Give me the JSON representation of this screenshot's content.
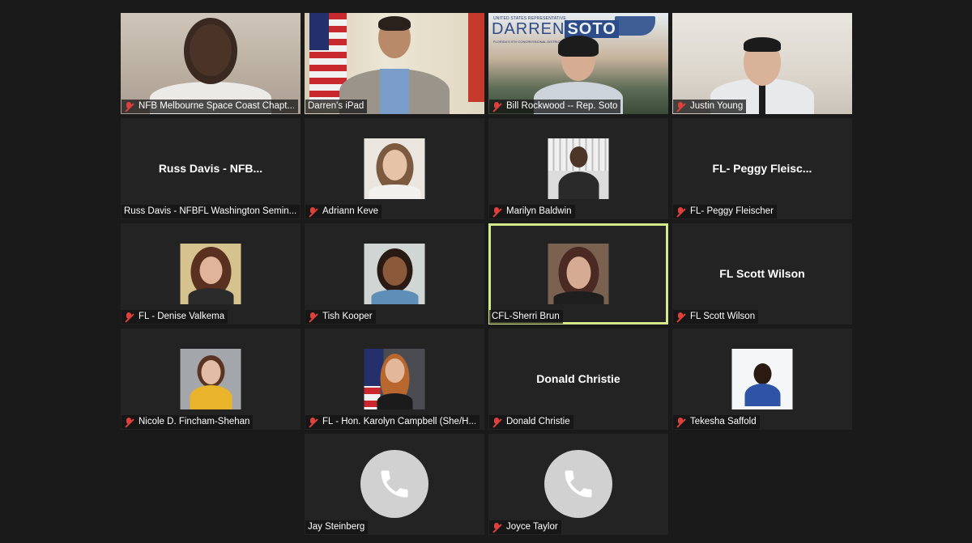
{
  "participants": [
    {
      "name": "NFB Melbourne Space Coast Chapt...",
      "muted": true,
      "kind": "video",
      "variant": "v1"
    },
    {
      "name": "Darren's iPad",
      "muted": false,
      "kind": "video",
      "variant": "v2"
    },
    {
      "name": "Bill Rockwood -- Rep. Soto",
      "muted": true,
      "kind": "video",
      "variant": "v3",
      "banner": {
        "small": "UNITED STATES REPRESENTATIVE",
        "title_a": "DARREN",
        "title_b": "SOTO",
        "tagline": "FLORIDA'S 9TH CONGRESSIONAL DISTRICT"
      }
    },
    {
      "name": "Justin Young",
      "muted": true,
      "kind": "video",
      "variant": "v4"
    },
    {
      "name": "Russ Davis - NFBFL Washington Semin...",
      "muted": false,
      "kind": "text",
      "display": "Russ Davis - NFB..."
    },
    {
      "name": "Adriann Keve",
      "muted": true,
      "kind": "photo",
      "photo": "p-adriann"
    },
    {
      "name": "Marilyn Baldwin",
      "muted": true,
      "kind": "photo",
      "photo": "p-marilyn"
    },
    {
      "name": "FL- Peggy Fleischer",
      "muted": true,
      "kind": "text",
      "display": "FL- Peggy Fleisc..."
    },
    {
      "name": "FL - Denise Valkema",
      "muted": true,
      "kind": "photo",
      "photo": "p-denise"
    },
    {
      "name": "Tish Kooper",
      "muted": true,
      "kind": "photo",
      "photo": "p-tish"
    },
    {
      "name": "CFL-Sherri Brun",
      "muted": false,
      "kind": "photo",
      "photo": "p-sherri",
      "active": true
    },
    {
      "name": "FL Scott Wilson",
      "muted": true,
      "kind": "text",
      "display": "FL Scott Wilson"
    },
    {
      "name": "Nicole D. Fincham-Shehan",
      "muted": true,
      "kind": "photo",
      "photo": "p-nicole"
    },
    {
      "name": "FL - Hon. Karolyn Campbell (She/H...",
      "muted": true,
      "kind": "photo",
      "photo": "p-karolyn"
    },
    {
      "name": "Donald Christie",
      "muted": true,
      "kind": "text",
      "display": "Donald Christie"
    },
    {
      "name": "Tekesha Saffold",
      "muted": true,
      "kind": "photo",
      "photo": "p-tekesha"
    },
    {
      "name": "Jay Steinberg",
      "muted": false,
      "kind": "phone"
    },
    {
      "name": "Joyce Taylor",
      "muted": true,
      "kind": "phone"
    }
  ]
}
